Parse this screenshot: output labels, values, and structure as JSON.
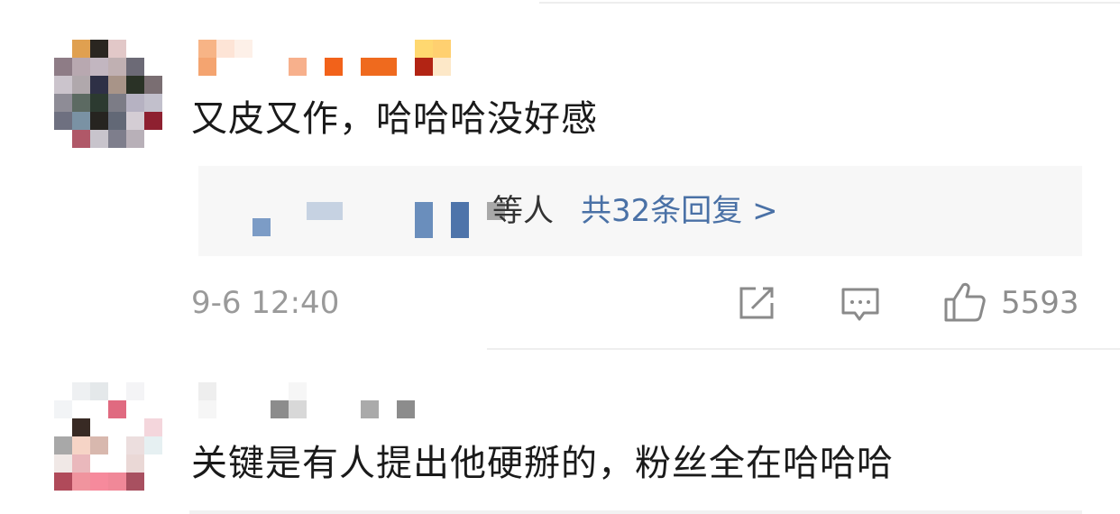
{
  "comments": [
    {
      "text": "又皮又作，哈哈哈没好感",
      "reply_preview_tail": "等人",
      "reply_count_label": "共32条回复 >",
      "time": "9-6 12:40",
      "like_count": "5593",
      "icons": [
        "share-icon",
        "comment-icon",
        "like-icon"
      ]
    },
    {
      "text": "关键是有人提出他硬掰的，粉丝全在哈哈哈"
    }
  ],
  "colors": {
    "reply_link": "#4a71a6",
    "meta_text": "#9a9a9a",
    "reply_background": "#f7f7f7"
  }
}
